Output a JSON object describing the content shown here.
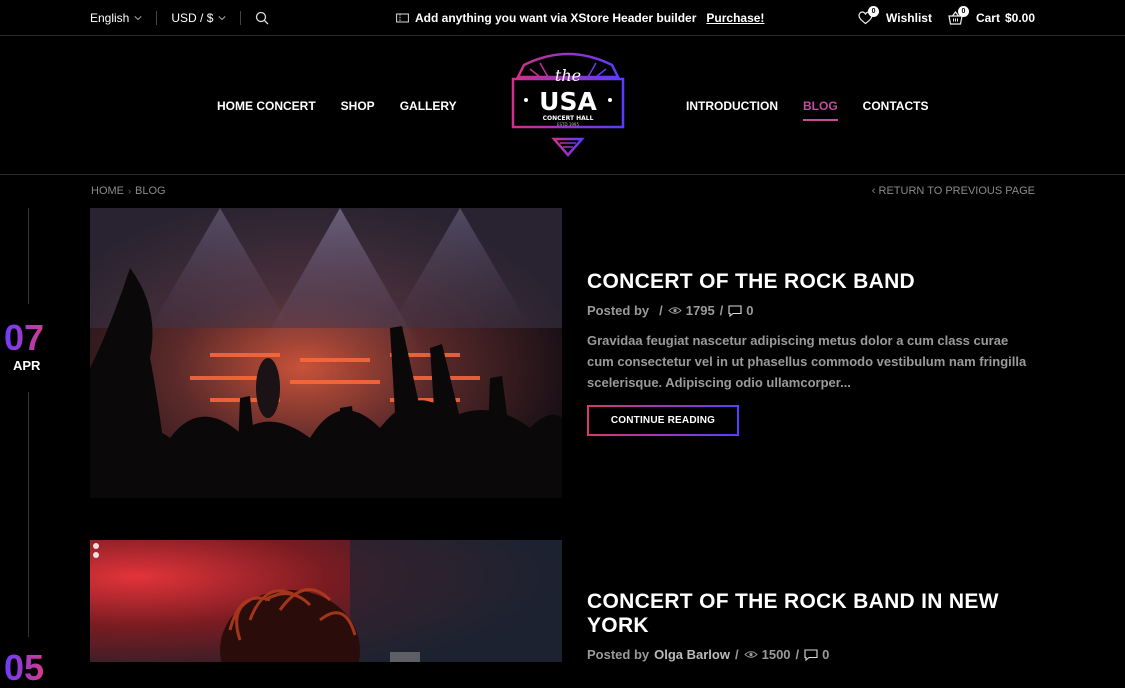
{
  "topbar": {
    "language": "English",
    "currency": "USD / $",
    "promo_text": "Add anything you want via XStore Header builder",
    "promo_link": "Purchase!",
    "wishlist_label": "Wishlist",
    "wishlist_count": "0",
    "cart_label": "Cart",
    "cart_total": "$0.00",
    "cart_count": "0"
  },
  "nav": {
    "left": [
      "HOME CONCERT",
      "SHOP",
      "GALLERY"
    ],
    "right": [
      "INTRODUCTION",
      "BLOG",
      "CONTACTS"
    ],
    "active": "BLOG"
  },
  "logo": {
    "top": "the",
    "main": "USA",
    "sub": "CONCERT HALL",
    "estd": "ESTD 1995"
  },
  "breadcrumb": {
    "items": [
      "HOME",
      "BLOG"
    ],
    "return_label": "RETURN TO PREVIOUS PAGE"
  },
  "posts": [
    {
      "day": "07",
      "month": "APR",
      "title": "CONCERT OF THE ROCK BAND",
      "posted_by": "Posted by",
      "author": "",
      "views": "1795",
      "comments": "0",
      "excerpt": "Gravidaa feugiat nascetur adipiscing metus dolor a cum class curae cum consectetur vel in ut phasellus commodo vestibulum nam fringilla scelerisque. Adipiscing odio ullamcorper...",
      "button": "CONTINUE READING"
    },
    {
      "day": "05",
      "month": "",
      "title": "CONCERT OF THE ROCK BAND IN NEW YORK",
      "posted_by": "Posted by",
      "author": "Olga Barlow",
      "views": "1500",
      "comments": "0"
    }
  ],
  "colors": {
    "accent": "#c74b9b",
    "gradient_start": "#6a3cff",
    "gradient_end": "#d63a8a",
    "background": "#000000"
  }
}
